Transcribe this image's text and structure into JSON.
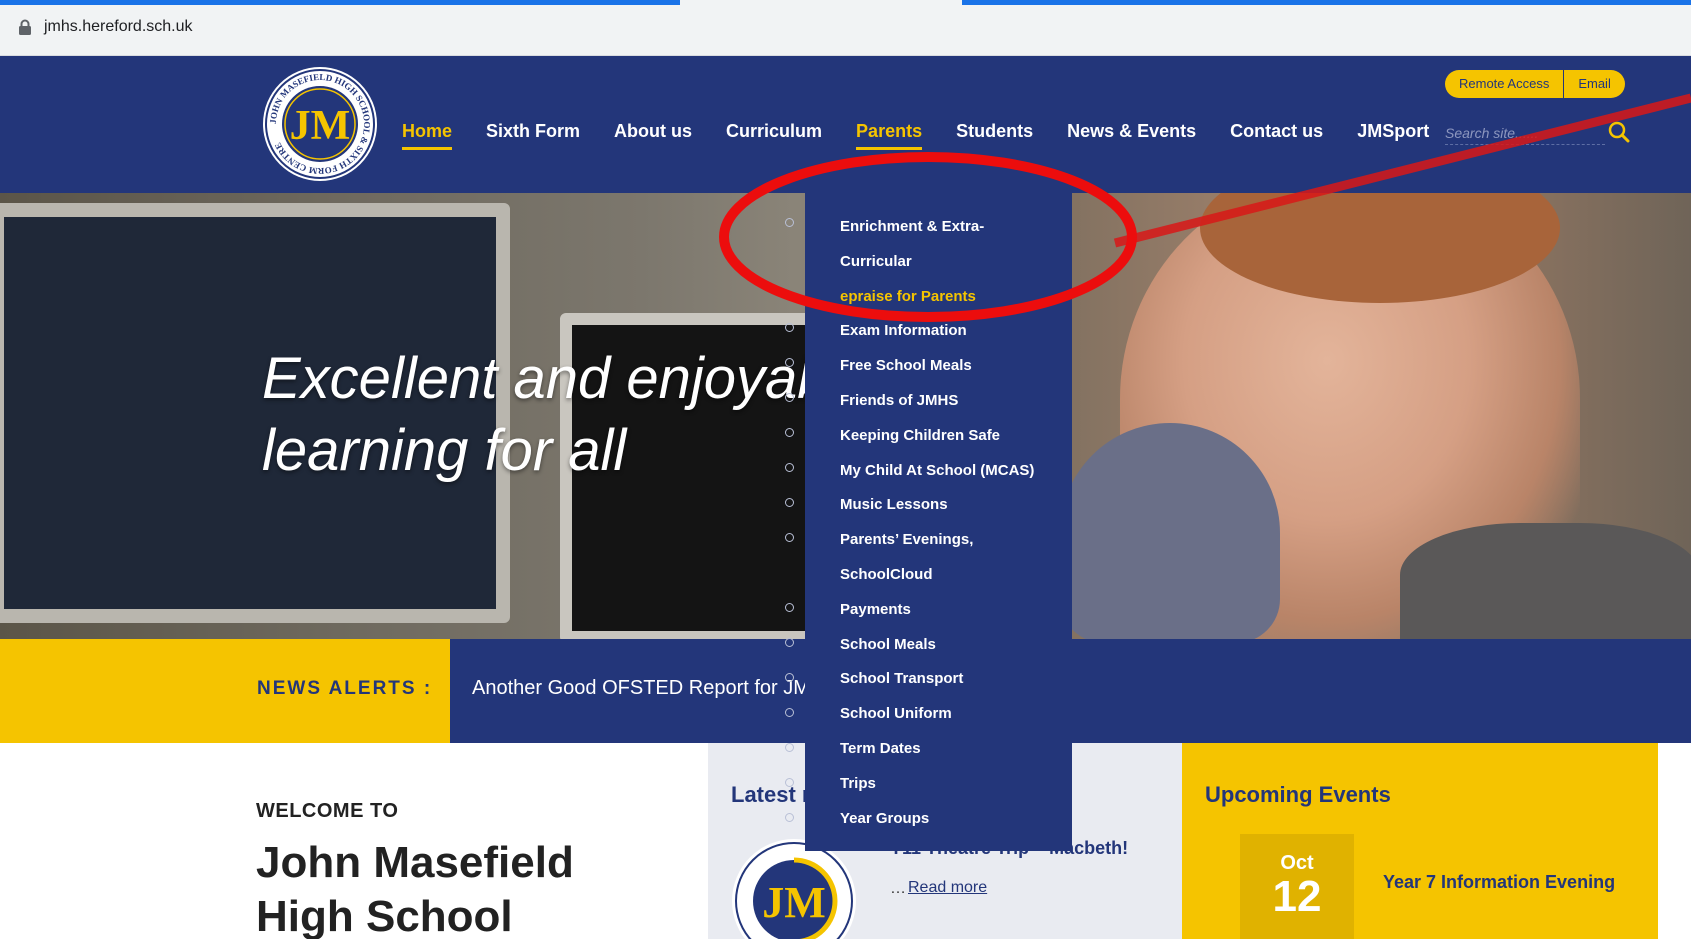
{
  "browser": {
    "url": "jmhs.hereford.sch.uk"
  },
  "header": {
    "logo": {
      "initials": "JM",
      "ring_text": "JOHN MASEFIELD HIGH SCHOOL & SIXTH FORM CENTRE"
    },
    "nav": {
      "home": "Home",
      "sixth_form": "Sixth Form",
      "about": "About us",
      "curriculum": "Curriculum",
      "parents": "Parents",
      "students": "Students",
      "news_events": "News & Events",
      "contact": "Contact us",
      "jmsport": "JMSport",
      "active_items": [
        "Home",
        "Parents"
      ]
    },
    "utility": {
      "remote_access": "Remote Access",
      "email": "Email"
    },
    "search": {
      "placeholder": "Search site......"
    }
  },
  "dropdown": {
    "items": [
      "Enrichment & Extra-",
      "Curricular",
      "epraise for Parents",
      "Exam Information",
      "Free School Meals",
      "Friends of JMHS",
      "Keeping Children Safe",
      "My Child At School (MCAS)",
      "Music Lessons",
      "Parents’ Evenings,",
      "SchoolCloud",
      "Payments",
      "School Meals",
      "School Transport",
      "School Uniform",
      "Term Dates",
      "Trips",
      "Year Groups"
    ],
    "highlighted_item": "epraise for Parents"
  },
  "hero": {
    "line1": "Excellent and enjoyable",
    "line2": "learning for all"
  },
  "news": {
    "label": "NEWS ALERTS :",
    "ticker": "Another Good OFSTED Report for JMHS"
  },
  "welcome": {
    "kicker": "WELCOME TO",
    "title": "John Masefield High School"
  },
  "latest": {
    "heading": "Latest news",
    "item_title": "Y11 Theatre Trip – Macbeth!",
    "ellipsis": "…",
    "read_more": "Read more"
  },
  "events": {
    "heading": "Upcoming Events",
    "month": "Oct",
    "day": "12",
    "title": "Year 7 Information Evening"
  },
  "colors": {
    "navy": "#23367a",
    "yellow": "#f5c400",
    "annotation_red": "#e01010"
  }
}
